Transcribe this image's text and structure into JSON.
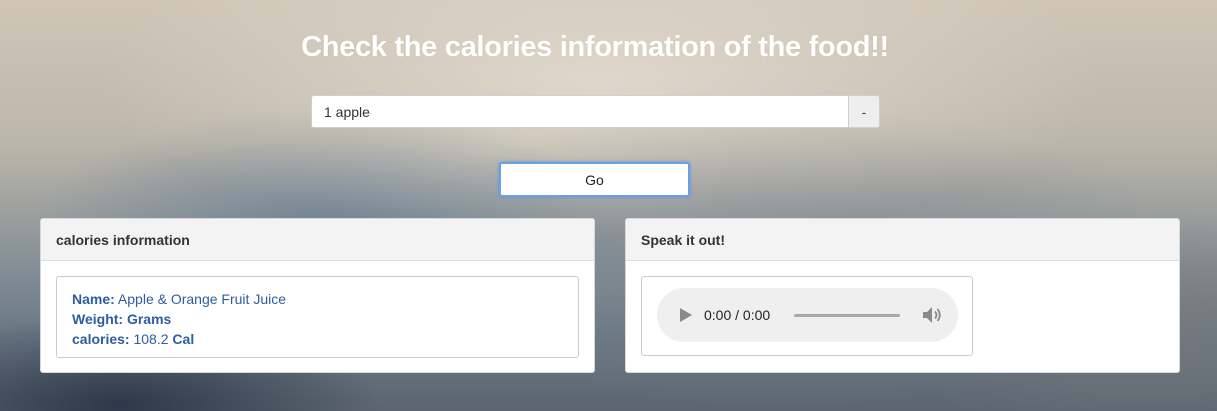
{
  "page": {
    "title": "Check the calories information of the food!!"
  },
  "search": {
    "value": "1 apple",
    "addon_label": "-",
    "go_label": "Go"
  },
  "calories_panel": {
    "heading": "calories information",
    "name_label": "Name:",
    "name_value": "Apple & Orange Fruit Juice",
    "weight_label": "Weight:",
    "weight_value": "Grams",
    "calories_label": "calories:",
    "calories_value": "108.2",
    "calories_unit": "Cal"
  },
  "speak_panel": {
    "heading": "Speak it out!",
    "audio_time": "0:00 / 0:00",
    "play_icon": "play-icon",
    "volume_icon": "volume-icon"
  },
  "colors": {
    "info_text": "#2e5d9f",
    "focus_ring": "#6aa0e6",
    "panel_heading_bg": "#f3f3f3"
  }
}
